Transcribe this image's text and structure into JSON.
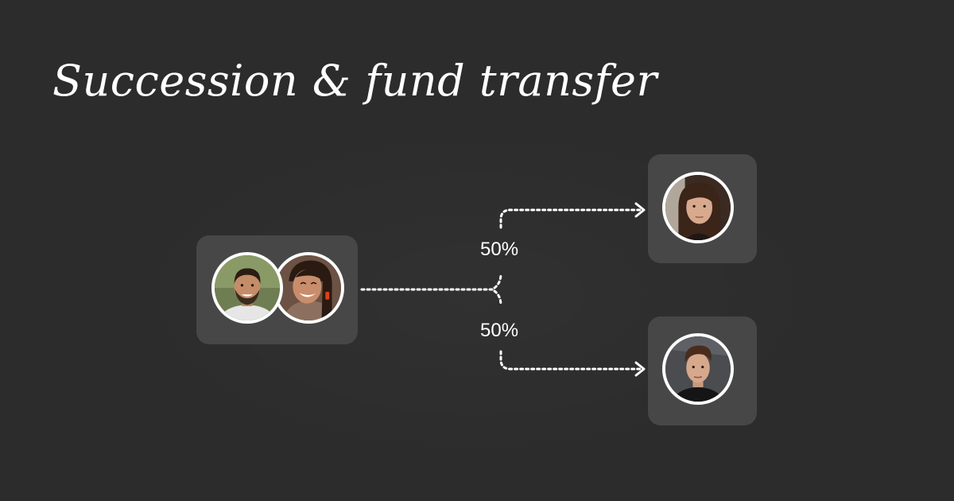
{
  "title": "Succession & fund transfer",
  "colors": {
    "background": "#2c2c2c",
    "card": "#474747",
    "text": "#ffffff",
    "connector": "#ffffff"
  },
  "source": {
    "avatars": [
      "smiling-bearded-man-photo",
      "laughing-woman-photo"
    ]
  },
  "splits": [
    {
      "percent": "50%",
      "avatar": "young-woman-photo"
    },
    {
      "percent": "50%",
      "avatar": "young-man-photo"
    }
  ]
}
